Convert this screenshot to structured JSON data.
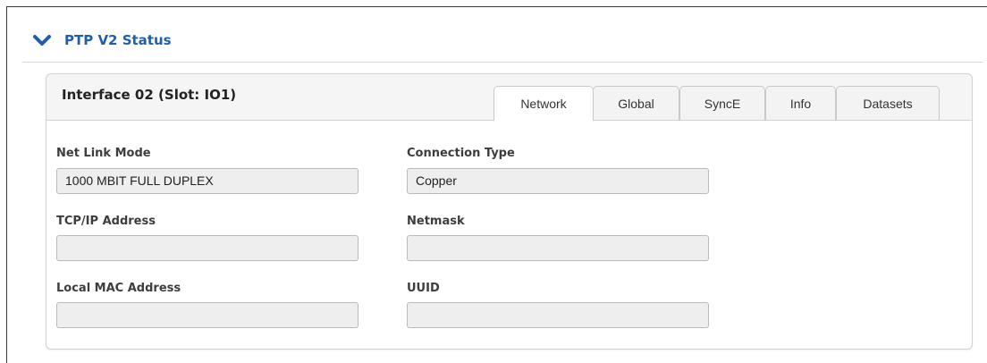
{
  "section": {
    "title": "PTP V2 Status",
    "accent_color": "#1f5fae",
    "toggle_icon": "chevron-down-icon",
    "expanded": true
  },
  "interface_panel": {
    "title": "Interface 02 (Slot: IO1)",
    "active_tab": "Network",
    "tabs": [
      {
        "label": "Network"
      },
      {
        "label": "Global"
      },
      {
        "label": "SyncE"
      },
      {
        "label": "Info"
      },
      {
        "label": "Datasets"
      }
    ]
  },
  "fields": {
    "net_link_mode": {
      "label": "Net Link Mode",
      "value": "1000 MBIT FULL DUPLEX"
    },
    "connection_type": {
      "label": "Connection Type",
      "value": "Copper"
    },
    "tcpip_address": {
      "label": "TCP/IP Address",
      "value": ""
    },
    "netmask": {
      "label": "Netmask",
      "value": ""
    },
    "local_mac_address": {
      "label": "Local MAC Address",
      "value": ""
    },
    "uuid": {
      "label": "UUID",
      "value": ""
    }
  }
}
